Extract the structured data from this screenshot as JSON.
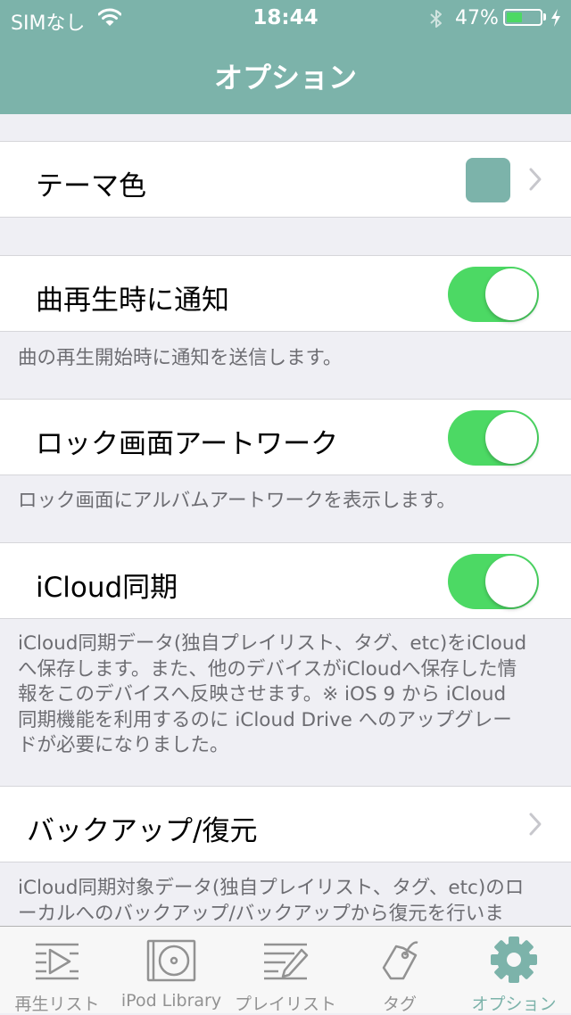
{
  "status_bar": {
    "carrier": "SIMなし",
    "time": "18:44",
    "battery_percent": "47%",
    "battery_level": 0.47
  },
  "nav": {
    "title": "オプション"
  },
  "colors": {
    "theme": "#7cb3aa",
    "toggle_on": "#4cd964",
    "tab_inactive": "#929292"
  },
  "settings": {
    "theme_color": {
      "label": "テーマ色",
      "swatch_color": "#7cb3aa"
    },
    "now_playing_notification": {
      "label": "曲再生時に通知",
      "enabled": true,
      "description": "曲の再生開始時に通知を送信します。"
    },
    "lock_screen_artwork": {
      "label": "ロック画面アートワーク",
      "enabled": true,
      "description": "ロック画面にアルバムアートワークを表示します。"
    },
    "icloud_sync": {
      "label": "iCloud同期",
      "enabled": true,
      "description_lines": [
        "iCloud同期データ(独自プレイリスト、タグ、etc)をiCloud",
        "へ保存します。また、他のデバイスがiCloudへ保存した情",
        "報をこのデバイスへ反映させます。※ iOS 9 から iCloud",
        "同期機能を利用するのに iCloud Drive へのアップグレー",
        "ドが必要になりました。"
      ]
    },
    "backup_restore": {
      "label": "バックアップ/復元",
      "description_lines": [
        "iCloud同期対象データ(独自プレイリスト、タグ、etc)のロ",
        "ーカルへのバックアップ/バックアップから復元を行いま"
      ]
    }
  },
  "tab_bar": {
    "items": [
      {
        "label": "再生リスト",
        "icon": "now-playing-list-icon",
        "active": false
      },
      {
        "label": "iPod Library",
        "icon": "ipod-library-icon",
        "active": false
      },
      {
        "label": "プレイリスト",
        "icon": "playlist-icon",
        "active": false
      },
      {
        "label": "タグ",
        "icon": "tag-icon",
        "active": false
      },
      {
        "label": "オプション",
        "icon": "gear-icon",
        "active": true
      }
    ]
  }
}
